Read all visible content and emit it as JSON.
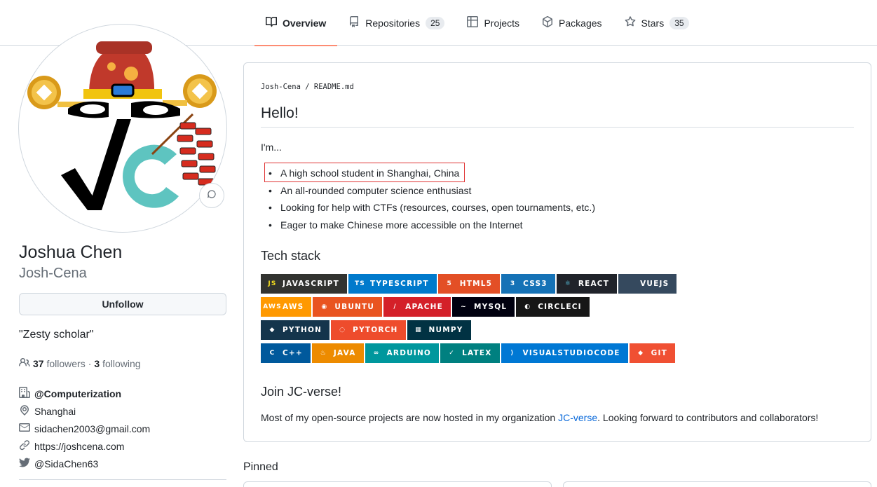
{
  "tabs": [
    {
      "label": "Overview",
      "icon": "book-icon"
    },
    {
      "label": "Repositories",
      "icon": "repo-icon",
      "count": "25"
    },
    {
      "label": "Projects",
      "icon": "table-icon"
    },
    {
      "label": "Packages",
      "icon": "package-icon"
    },
    {
      "label": "Stars",
      "icon": "star-icon",
      "count": "35"
    }
  ],
  "profile": {
    "name": "Joshua Chen",
    "login": "Josh-Cena",
    "unfollow_label": "Unfollow",
    "bio": "\"Zesty scholar\"",
    "followers_count": "37",
    "followers_label": "followers",
    "separator": "·",
    "following_count": "3",
    "following_label": "following",
    "org": "@Computerization",
    "location": "Shanghai",
    "email": "sidachen2003@gmail.com",
    "website": "https://joshcena.com",
    "twitter": "@SidaChen63"
  },
  "readme": {
    "owner": "Josh-Cena",
    "sep": "/",
    "file": "README.md",
    "heading": "Hello!",
    "intro": "I'm...",
    "items": [
      "A high school student in Shanghai, China",
      "An all-rounded computer science enthusiast",
      "Looking for help with CTFs (resources, courses, open tournaments, etc.)",
      "Eager to make Chinese more accessible on the Internet"
    ],
    "tech_heading": "Tech stack",
    "badges": [
      [
        {
          "label": "JAVASCRIPT",
          "bg": "#323330",
          "logo": "JS",
          "logo_color": "#F7DF1E"
        },
        {
          "label": "TYPESCRIPT",
          "bg": "#007ACC",
          "logo": "TS",
          "logo_color": "#ffffff"
        },
        {
          "label": "HTML5",
          "bg": "#E34F26",
          "logo": "5",
          "logo_color": "#ffffff"
        },
        {
          "label": "CSS3",
          "bg": "#1572B6",
          "logo": "3",
          "logo_color": "#ffffff"
        },
        {
          "label": "REACT",
          "bg": "#20232A",
          "logo": "⚛",
          "logo_color": "#61DAFB"
        },
        {
          "label": "VUEJS",
          "bg": "#35495E",
          "logo": "",
          "logo_color": "#4FC08D"
        }
      ],
      [
        {
          "label": "AWS",
          "bg": "#FF9900",
          "logo": "aws",
          "logo_color": "#ffffff"
        },
        {
          "label": "UBUNTU",
          "bg": "#E95420",
          "logo": "◉",
          "logo_color": "#ffffff"
        },
        {
          "label": "APACHE",
          "bg": "#D42029",
          "logo": "/",
          "logo_color": "#ffffff"
        },
        {
          "label": "MYSQL",
          "bg": "#00000F",
          "logo": "~",
          "logo_color": "#ffffff"
        },
        {
          "label": "CIRCLECI",
          "bg": "#161616",
          "logo": "◐",
          "logo_color": "#ffffff"
        }
      ],
      [
        {
          "label": "PYTHON",
          "bg": "#14354C",
          "logo": "◆",
          "logo_color": "#ffffff"
        },
        {
          "label": "PYTORCH",
          "bg": "#EE4C2C",
          "logo": "◌",
          "logo_color": "#ffffff"
        },
        {
          "label": "NUMPY",
          "bg": "#013243",
          "logo": "▦",
          "logo_color": "#ffffff"
        }
      ],
      [
        {
          "label": "C++",
          "bg": "#00599C",
          "logo": "C",
          "logo_color": "#ffffff"
        },
        {
          "label": "JAVA",
          "bg": "#ED8B00",
          "logo": "♨",
          "logo_color": "#ffffff"
        },
        {
          "label": "ARDUINO",
          "bg": "#00979D",
          "logo": "∞",
          "logo_color": "#ffffff"
        },
        {
          "label": "LATEX",
          "bg": "#008080",
          "logo": "✓",
          "logo_color": "#ffffff"
        },
        {
          "label": "VISUALSTUDIOCODE",
          "bg": "#0078D4",
          "logo": "⟩",
          "logo_color": "#ffffff"
        },
        {
          "label": "GIT",
          "bg": "#F05033",
          "logo": "◆",
          "logo_color": "#ffffff"
        }
      ]
    ],
    "join_heading": "Join JC-verse!",
    "para_before": "Most of my open-source projects are now hosted in my organization ",
    "para_link": "JC-verse",
    "para_after": ". Looking forward to contributors and collaborators!"
  },
  "pinned_label": "Pinned",
  "colors": {
    "accent_underline": "#fd8c73",
    "link": "#0969da",
    "highlight_box": "#e03434"
  }
}
